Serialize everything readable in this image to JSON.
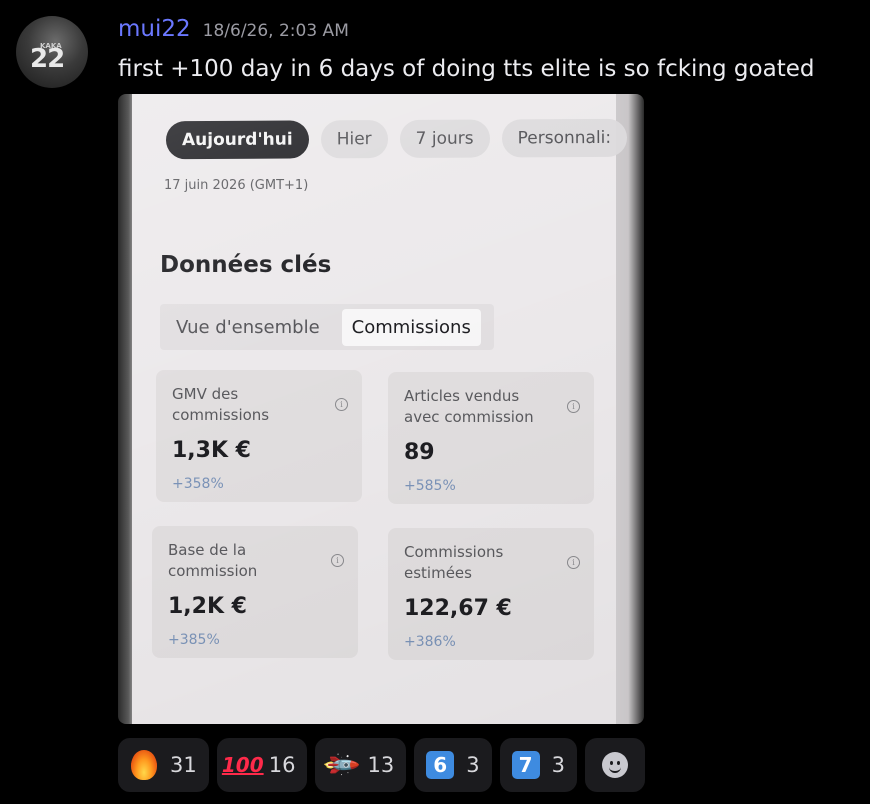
{
  "message": {
    "username": "mui22",
    "timestamp": "18/6/26, 2:03 AM",
    "text": "first +100 day in 6 days of doing tts elite is so fcking goated",
    "avatar_label": "KAKA",
    "avatar_number": "22"
  },
  "screenshot": {
    "date_tabs": [
      {
        "label": "Aujourd'hui",
        "active": true
      },
      {
        "label": "Hier",
        "active": false
      },
      {
        "label": "7 jours",
        "active": false
      },
      {
        "label": "Personnali:",
        "active": false
      }
    ],
    "date_label": "17 juin 2026 (GMT+1)",
    "section_title": "Données clés",
    "segments": [
      {
        "label": "Vue d'ensemble",
        "active": false
      },
      {
        "label": "Commissions",
        "active": true
      }
    ],
    "cards": [
      {
        "label": "GMV des commissions",
        "value": "1,3K €",
        "change": "+358%"
      },
      {
        "label": "Articles vendus avec commission",
        "value": "89",
        "change": "+585%"
      },
      {
        "label": "Base de la commission",
        "value": "1,2K €",
        "change": "+385%"
      },
      {
        "label": "Commissions estimées",
        "value": "122,67 €",
        "change": "+386%"
      }
    ],
    "info_icon_glyph": "i"
  },
  "reactions": [
    {
      "icon": "fire-emoji",
      "count": "31"
    },
    {
      "icon": "hundred-points-emoji",
      "glyph": "100",
      "count": "16"
    },
    {
      "icon": "rocket-emoji",
      "glyph": "🚀",
      "count": "13"
    },
    {
      "icon": "keycap-six-emoji",
      "glyph": "6",
      "count": "3"
    },
    {
      "icon": "keycap-seven-emoji",
      "glyph": "7",
      "count": "3"
    }
  ],
  "colors": {
    "username": "#6b78ff",
    "background": "#000000",
    "reaction_bg": "#1b1b1e",
    "keycap": "#3e8be0",
    "change_text": "#7b93b8"
  }
}
